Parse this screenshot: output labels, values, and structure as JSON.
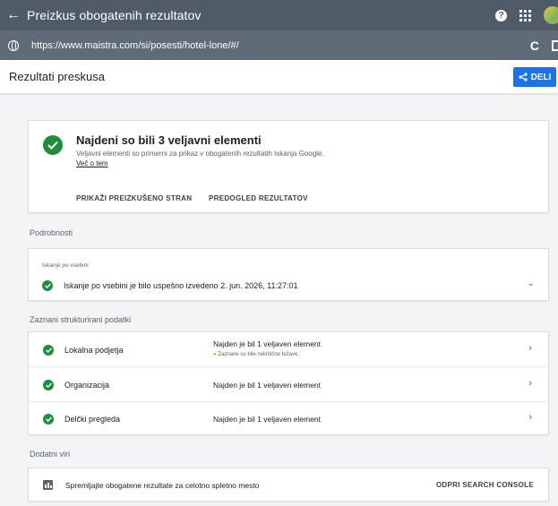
{
  "top_bar": {
    "back_icon": "arrow-left-icon",
    "title": "Preizkus obogatenih rezultatov",
    "help_label": "?"
  },
  "url_bar": {
    "url": "https://www.maistra.com/si/posesti/hotel-lone/#/",
    "reload_glyph": "C"
  },
  "header": {
    "title": "Rezultati preskusa",
    "share_label": "DELI"
  },
  "summary": {
    "heading": "Najdeni so bili 3 veljavni elementi",
    "subtext": "Veljavni elementi so primerni za prikaz v obogatenih rezultatih Iskanja Google.",
    "more_link": "Več o tem",
    "action_view": "PRIKAŽI PREIZKUŠENO STRAN",
    "action_preview": "PREDOGLED REZULTATOV"
  },
  "details": {
    "section_label": "Podrobnosti",
    "card_label": "Iskanje po vsebini",
    "status_text": "Iskanje po vsebini je bilo uspešno izvedeno 2. jun. 2026, 11:27:01"
  },
  "structured": {
    "section_label": "Zaznani strukturirani podatki",
    "rows": [
      {
        "name": "Lokalna podjetja",
        "status": "Najden je bil 1 veljaven element",
        "warning": "Zaznane so bile nekritične težave.",
        "warning_glyph": "●"
      },
      {
        "name": "Organizacija",
        "status": "Najden je bil 1 veljaven element"
      },
      {
        "name": "Delčki pregleda",
        "status": "Najden je bil 1 veljaven element"
      }
    ]
  },
  "resources": {
    "section_label": "Dodatni viri",
    "text": "Spremljajte obogatene rezultate za celotno spletno mesto",
    "action": "ODPRI SEARCH CONSOLE"
  },
  "colors": {
    "top_bar": "#4f5b67",
    "url_bar": "#5f6b77",
    "accent_blue": "#1a73e8",
    "success_green": "#1e8e3e",
    "warning_orange": "#f29900"
  }
}
